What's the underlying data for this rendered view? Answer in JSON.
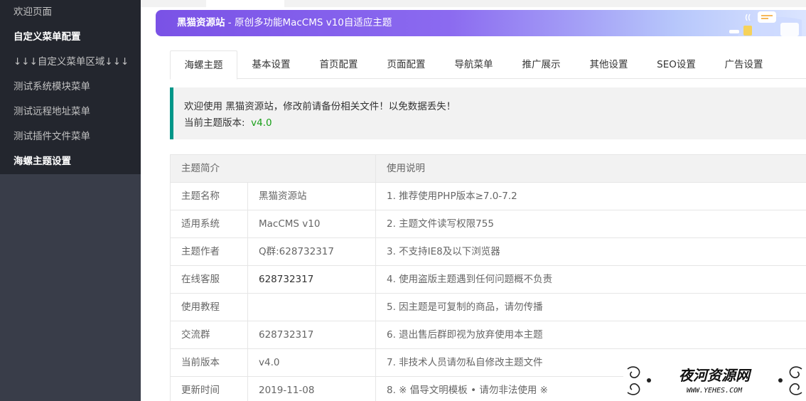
{
  "sidebar": {
    "items": [
      {
        "label": "欢迎页面"
      },
      {
        "label": "自定义菜单配置"
      },
      {
        "label": "↓↓↓自定义菜单区域↓↓↓"
      },
      {
        "label": "测试系统模块菜单"
      },
      {
        "label": "测试远程地址菜单"
      },
      {
        "label": "测试插件文件菜单"
      },
      {
        "label": "海螺主题设置"
      }
    ]
  },
  "banner": {
    "brand": "黑猫资源站",
    "subtitle": " - 原创多功能MacCMS v10自适应主题"
  },
  "tabs": [
    {
      "label": "海螺主题"
    },
    {
      "label": "基本设置"
    },
    {
      "label": "首页配置"
    },
    {
      "label": "页面配置"
    },
    {
      "label": "导航菜单"
    },
    {
      "label": "推广展示"
    },
    {
      "label": "其他设置"
    },
    {
      "label": "SEO设置"
    },
    {
      "label": "广告设置"
    }
  ],
  "notice": {
    "line1": "欢迎使用 黑猫资源站，修改前请备份相关文件！以免数据丢失！",
    "version_label": "当前主题版本:",
    "version_value": "v4.0"
  },
  "table": {
    "header_left": "主题简介",
    "header_right": "使用说明",
    "rows": [
      {
        "key": "主题名称",
        "value": "黑猫资源站",
        "note": "1. 推荐使用PHP版本≥7.0-7.2"
      },
      {
        "key": "适用系统",
        "value": "MacCMS v10",
        "note": "2. 主题文件读写权限755"
      },
      {
        "key": "主题作者",
        "value": "Q群:628732317",
        "note": "3. 不支持IE8及以下浏览器"
      },
      {
        "key": "在线客服",
        "value": "628732317",
        "note": "4. 使用盗版主题遇到任何问题概不负责"
      },
      {
        "key": "使用教程",
        "value": "",
        "note": "5. 因主题是可复制的商品，请勿传播"
      },
      {
        "key": "交流群",
        "value": "628732317",
        "note": "6. 退出售后群即视为放弃使用本主题"
      },
      {
        "key": "当前版本",
        "value": "v4.0",
        "note": "7. 非技术人员请勿私自修改主题文件"
      },
      {
        "key": "更新时间",
        "value": "2019-11-08",
        "note": "8. ※ 倡导文明模板 • 请勿非法使用 ※"
      }
    ]
  },
  "watermark": {
    "title": "夜河资源网",
    "url": "WWW.YEHES.COM"
  },
  "colors": {
    "sidebar_bg": "#393d49",
    "sidebar_active_bg": "#23262e",
    "notice_accent": "#009688",
    "version_green": "#1aa01a"
  }
}
